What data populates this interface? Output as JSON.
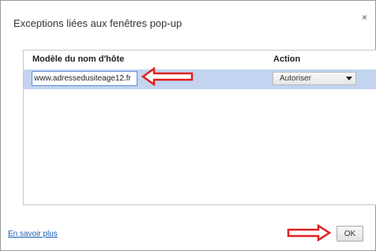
{
  "dialog": {
    "title": "Exceptions liées aux fenêtres pop-up",
    "close_glyph": "×",
    "close_icon": "close-icon"
  },
  "table": {
    "host_header": "Modèle du nom d'hôte",
    "action_header": "Action",
    "rows": [
      {
        "host_value": "www.adressedusiteage12.fr",
        "action": "Autoriser",
        "action_icon": "chevron-down-icon"
      }
    ]
  },
  "footer": {
    "learn_more": "En savoir plus",
    "ok_label": "OK"
  },
  "annotations": {
    "arrow_color": "#e02020",
    "arrow_icons": [
      "red-arrow-left-icon",
      "red-arrow-right-icon"
    ]
  },
  "colors": {
    "selected_row": "#c3d4f0",
    "input_focus_border": "#5b8ed6",
    "link": "#1a5fb4"
  }
}
